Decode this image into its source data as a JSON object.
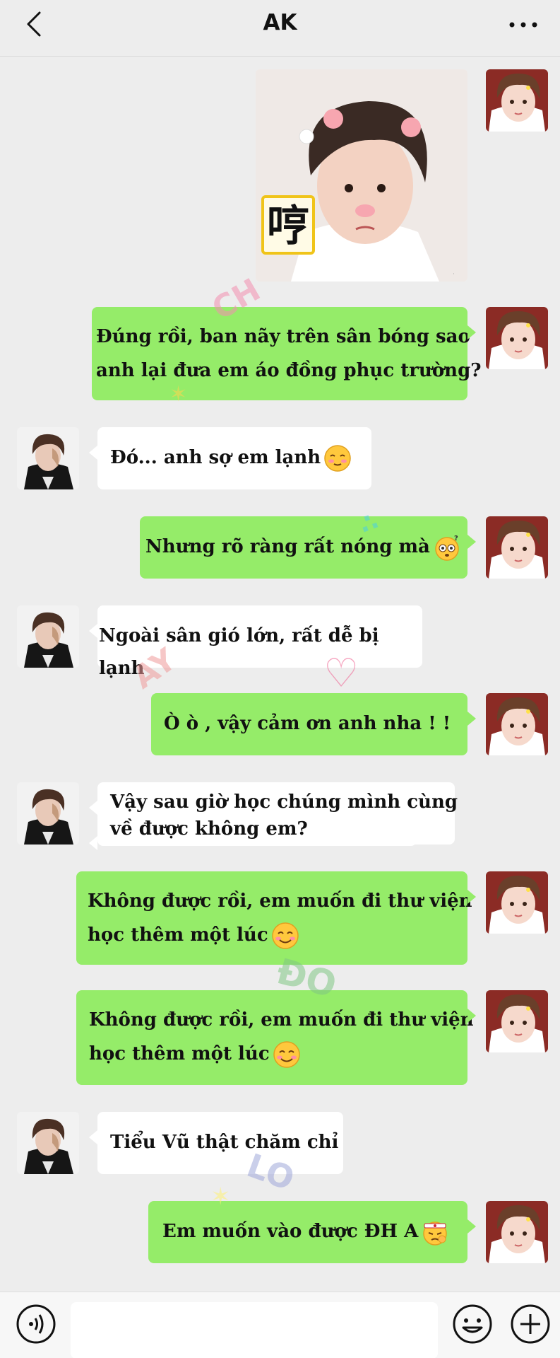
{
  "header": {
    "title": "AK"
  },
  "sticker": {
    "char": "哼"
  },
  "deco": {
    "w1": "CH",
    "w2": "AY",
    "w3": "ĐO",
    "w4": "LO"
  },
  "messages": [
    {
      "lines": [
        "Đúng rồi, ban nãy trên sân bóng sao",
        "anh lại đưa em áo đồng phục trường?"
      ]
    },
    {
      "lines": [
        "Đó... anh sợ em lạnh"
      ]
    },
    {
      "lines": [
        "Nhưng rõ ràng rất nóng mà"
      ]
    },
    {
      "lines": [
        "Ngoài sân gió lớn, rất dễ bị lạnh"
      ]
    },
    {
      "lines": [
        "Ò ò , vậy cảm ơn anh nha ! !"
      ]
    },
    {
      "lines": [
        "Vậy sau giờ học chúng mình cùng",
        "về được không em?"
      ]
    },
    {
      "lines": [
        "Không được rồi, em muốn đi thư viện",
        "học thêm một lúc"
      ]
    },
    {
      "lines": [
        "Không được rồi, em muốn đi thư viện",
        "học thêm một lúc"
      ]
    },
    {
      "lines": [
        "Tiểu Vũ thật chăm chỉ"
      ]
    },
    {
      "lines": [
        "Em muốn vào được ĐH A"
      ]
    }
  ],
  "icons": {
    "back": "chevron-left-icon",
    "more": "more-dots-icon",
    "voice": "voice-icon",
    "emoji": "emoji-icon",
    "plus": "plus-icon"
  },
  "colors": {
    "me_bubble": "#95ec69",
    "them_bubble": "#ffffff",
    "background": "#ededed"
  }
}
